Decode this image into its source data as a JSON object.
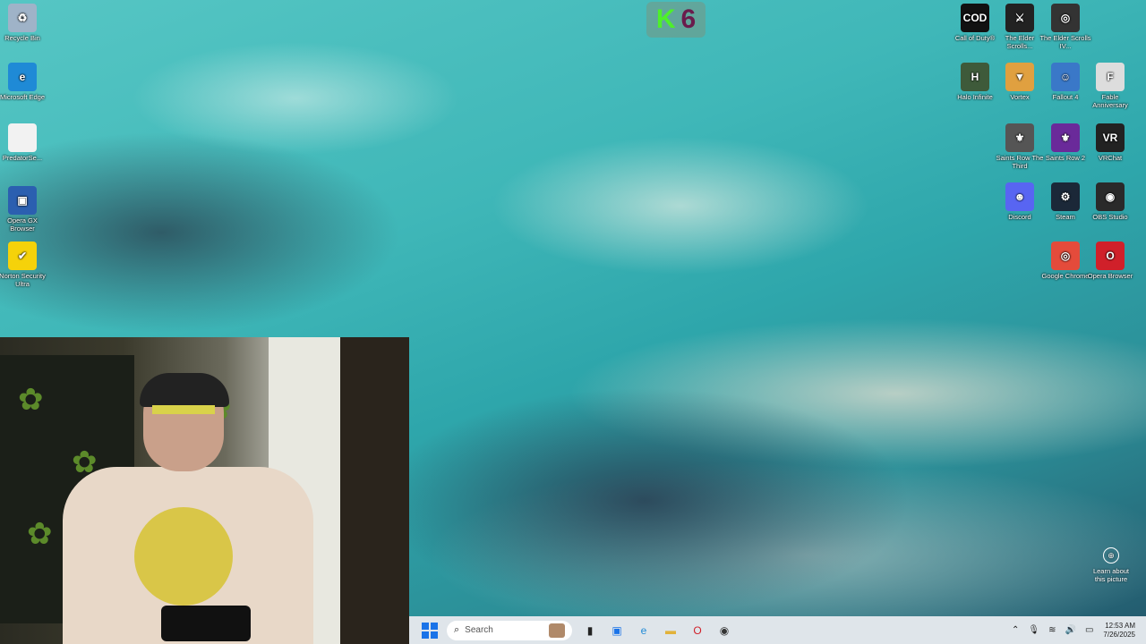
{
  "logo": {
    "left": "K",
    "right": "6"
  },
  "desktop_left": [
    {
      "name": "recycle-bin",
      "label": "Recycle Bin",
      "glyph": "♻",
      "bg": "#9fb3c8"
    },
    {
      "name": "microsoft-edge",
      "label": "Microsoft Edge",
      "glyph": "e",
      "bg": "#1f8ad6"
    },
    {
      "name": "predator-sense",
      "label": "PredatorSe...",
      "glyph": "",
      "bg": "#f2f2f2"
    },
    {
      "name": "opera-gx",
      "label": "Opera GX Browser",
      "glyph": "▣",
      "bg": "#2b5fb0"
    },
    {
      "name": "norton",
      "label": "Norton Security Ultra",
      "glyph": "✔",
      "bg": "#f5d20a"
    }
  ],
  "desktop_right": [
    {
      "name": "call-of-duty",
      "label": "Call of Duty®",
      "glyph": "COD",
      "bg": "#111"
    },
    {
      "name": "elder-scrolls-1",
      "label": "The Elder Scrolls...",
      "glyph": "⚔",
      "bg": "#222"
    },
    {
      "name": "elder-scrolls-4",
      "label": "The Elder Scrolls IV...",
      "glyph": "◎",
      "bg": "#333"
    },
    {
      "name": "halo-infinite",
      "label": "Halo Infinite",
      "glyph": "H",
      "bg": "#3e5a3a"
    },
    {
      "name": "vortex",
      "label": "Vortex",
      "glyph": "▼",
      "bg": "#e0a040"
    },
    {
      "name": "fallout-4",
      "label": "Fallout 4",
      "glyph": "☺",
      "bg": "#3a78c8"
    },
    {
      "name": "fable-anniversary",
      "label": "Fable Anniversary",
      "glyph": "F",
      "bg": "#ddd"
    },
    {
      "name": "saints-row-third",
      "label": "Saints Row The Third",
      "glyph": "⚜",
      "bg": "#555"
    },
    {
      "name": "saints-row-2",
      "label": "Saints Row 2",
      "glyph": "⚜",
      "bg": "#6a2a9a"
    },
    {
      "name": "vrchat",
      "label": "VRChat",
      "glyph": "VR",
      "bg": "#222"
    },
    {
      "name": "discord",
      "label": "Discord",
      "glyph": "☻",
      "bg": "#5865f2"
    },
    {
      "name": "steam",
      "label": "Steam",
      "glyph": "⚙",
      "bg": "#1b2838"
    },
    {
      "name": "obs-studio",
      "label": "OBS Studio",
      "glyph": "◉",
      "bg": "#2a2a2a"
    },
    {
      "name": "google-chrome",
      "label": "Google Chrome",
      "glyph": "◎",
      "bg": "#e44b3b"
    },
    {
      "name": "opera-browser",
      "label": "Opera Browser",
      "glyph": "O",
      "bg": "#d0202a"
    }
  ],
  "learn": {
    "label": "Learn about this picture",
    "glyph": "⊕"
  },
  "taskbar": {
    "search_placeholder": "Search",
    "search_glyph": "⌕",
    "apps": [
      {
        "name": "task-view",
        "glyph": "▮",
        "color": "#222"
      },
      {
        "name": "widgets",
        "glyph": "▣",
        "color": "#1a73e8"
      },
      {
        "name": "edge",
        "glyph": "e",
        "color": "#1f8ad6"
      },
      {
        "name": "file-explorer",
        "glyph": "▬",
        "color": "#e2b23a"
      },
      {
        "name": "opera",
        "glyph": "O",
        "color": "#d0202a"
      },
      {
        "name": "obs",
        "glyph": "◉",
        "color": "#333"
      }
    ],
    "tray": {
      "chevron": "⌃",
      "mic": "🎙",
      "wifi": "≋",
      "volume": "🔊",
      "battery": "▭"
    },
    "time": "12:53 AM",
    "date": "7/26/2025"
  }
}
